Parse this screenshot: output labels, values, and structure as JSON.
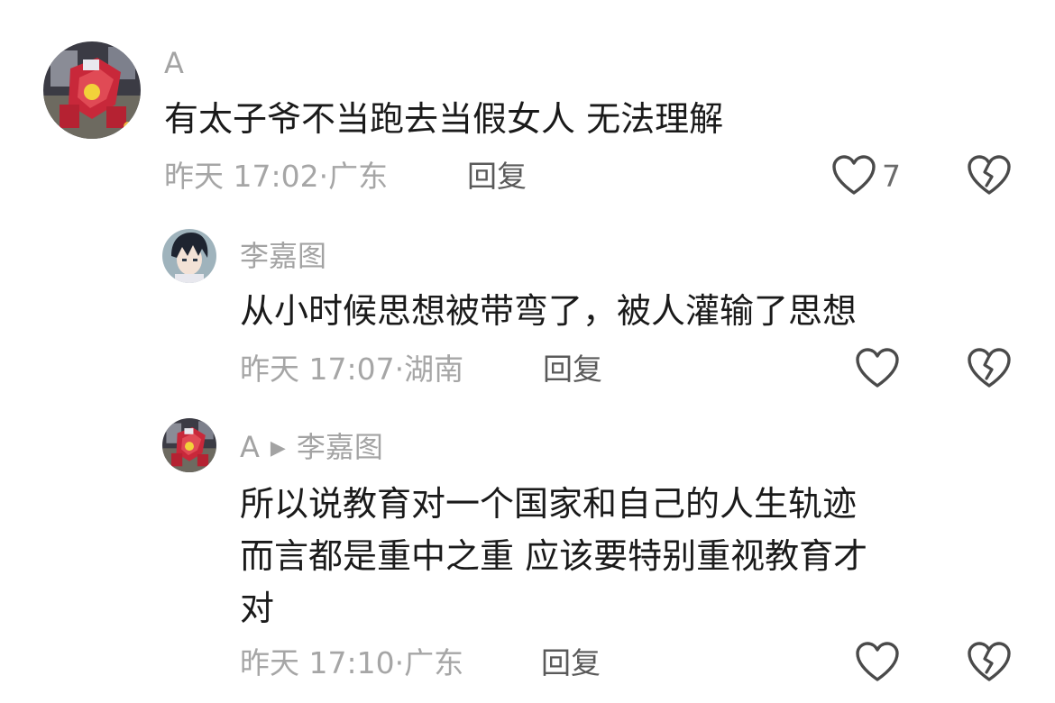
{
  "comments": [
    {
      "username": "A",
      "text": "有太子爷不当跑去当假女人 无法理解",
      "time": "昨天 17:02",
      "location": "广东",
      "reply_label": "回复",
      "like_count": "7"
    },
    {
      "username": "李嘉图",
      "text": "从小时候思想被带弯了，被人灌输了思想",
      "time": "昨天 17:07",
      "location": "湖南",
      "reply_label": "回复",
      "like_count": ""
    },
    {
      "username": "A",
      "reply_to_arrow": "▶",
      "reply_to": "李嘉图",
      "text": "所以说教育对一个国家和自己的人生轨迹\n而言都是重中之重 应该要特别重视教育才\n对",
      "time": "昨天 17:10",
      "location": "广东",
      "reply_label": "回复",
      "like_count": ""
    }
  ],
  "icons": {
    "like": "heart-outline-icon",
    "dislike": "broken-heart-outline-icon"
  },
  "colors": {
    "text": "#1a1a1a",
    "meta": "#a6a6a6",
    "reply": "#5a5a5a",
    "icon": "#4a4a4a"
  }
}
